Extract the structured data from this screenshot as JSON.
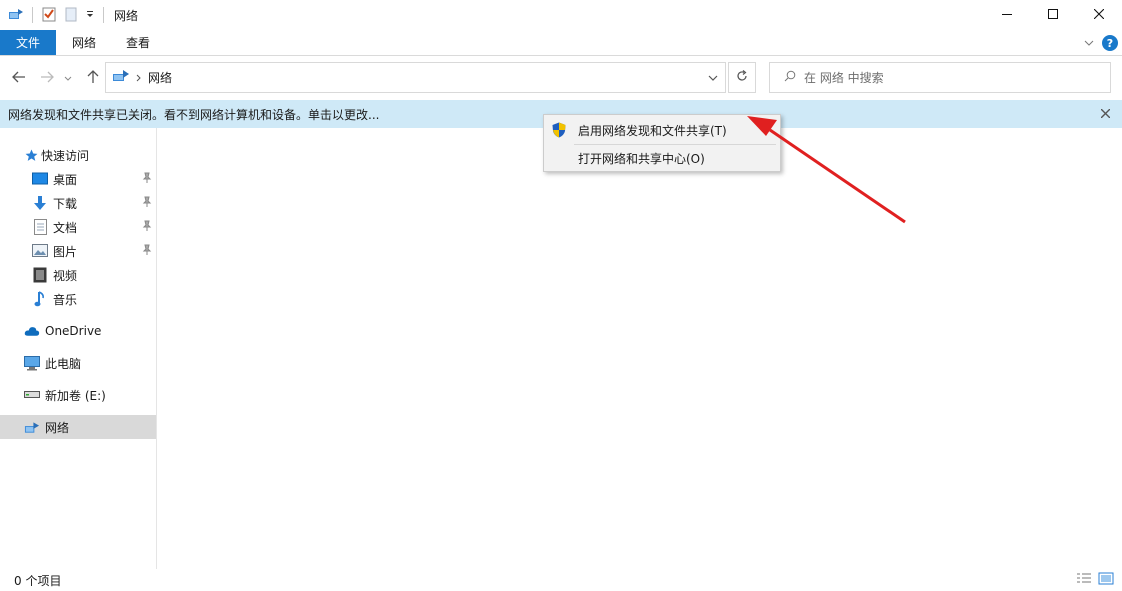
{
  "titlebar": {
    "title": "网络",
    "minimize_icon": "minimize-icon",
    "maximize_icon": "maximize-icon",
    "close_icon": "close-icon"
  },
  "ribbon": {
    "tabs": [
      {
        "label": "文件"
      },
      {
        "label": "网络"
      },
      {
        "label": "查看"
      }
    ]
  },
  "address": {
    "path": "网络"
  },
  "search": {
    "placeholder": "在 网络 中搜索"
  },
  "infobar": {
    "message": "网络发现和文件共享已关闭。看不到网络计算机和设备。单击以更改..."
  },
  "sidebar": {
    "quick_access": "快速访问",
    "items": [
      {
        "label": "桌面",
        "pinned": true
      },
      {
        "label": "下载",
        "pinned": true
      },
      {
        "label": "文档",
        "pinned": true
      },
      {
        "label": "图片",
        "pinned": true
      },
      {
        "label": "视频",
        "pinned": false
      },
      {
        "label": "音乐",
        "pinned": false
      }
    ],
    "onedrive": "OneDrive",
    "this_pc": "此电脑",
    "drive": "新加卷 (E:)",
    "network": "网络"
  },
  "context_menu": {
    "items": [
      {
        "label": "启用网络发现和文件共享(T)"
      },
      {
        "label": "打开网络和共享中心(O)"
      }
    ]
  },
  "status": {
    "item_count": "0 个项目"
  },
  "colors": {
    "accent": "#1979ca",
    "infobar_bg": "#cfe9f7",
    "annotation_arrow": "#e02020"
  }
}
